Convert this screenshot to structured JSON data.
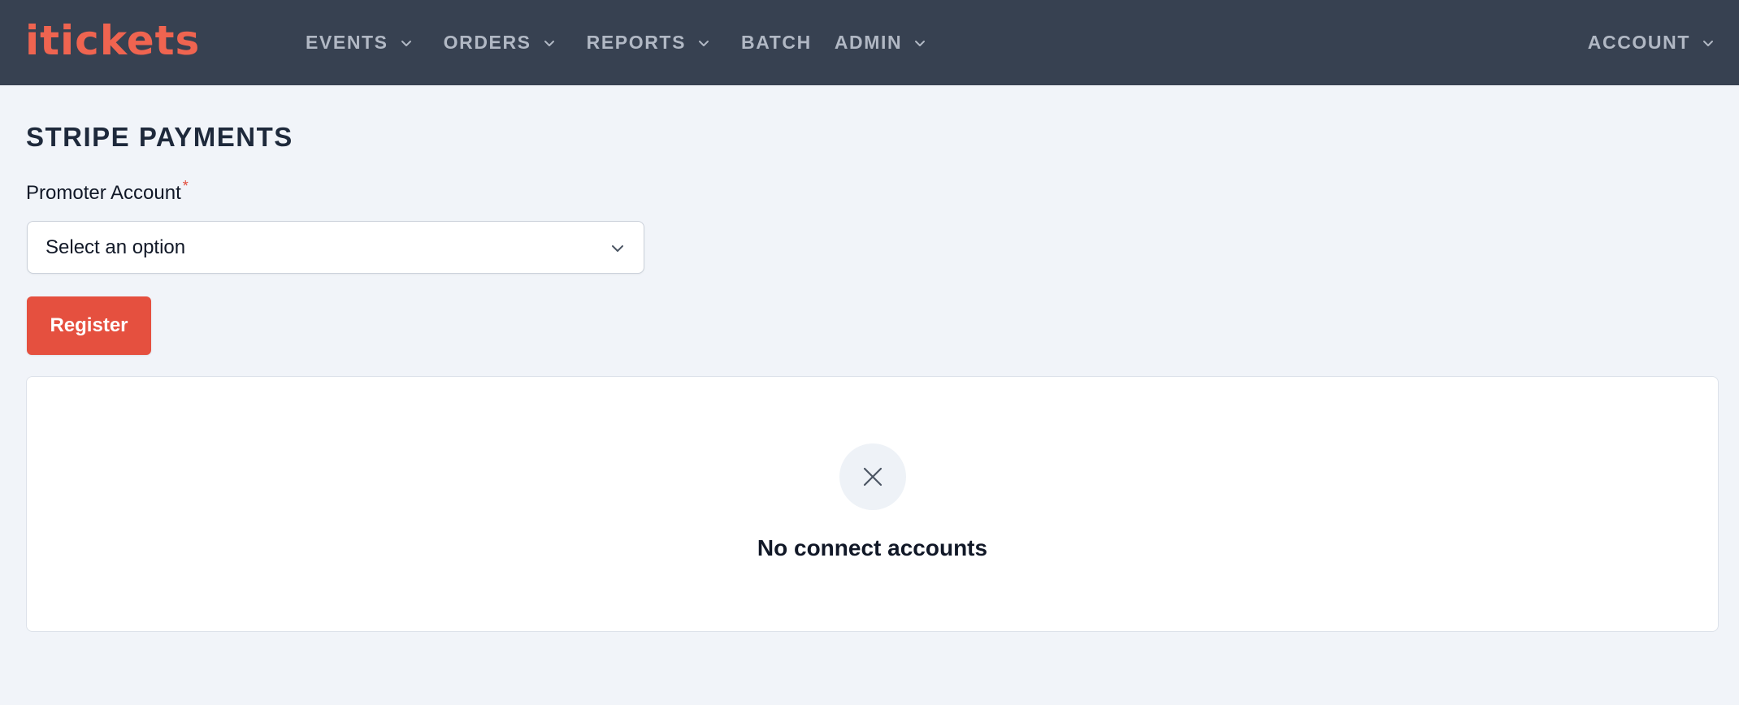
{
  "brand": {
    "logo_text": "iTickets",
    "accent_color": "#e5503f"
  },
  "nav": {
    "items": [
      {
        "label": "EVENTS",
        "has_dropdown": true
      },
      {
        "label": "ORDERS",
        "has_dropdown": true
      },
      {
        "label": "REPORTS",
        "has_dropdown": true
      },
      {
        "label": "BATCH",
        "has_dropdown": false
      },
      {
        "label": "ADMIN",
        "has_dropdown": true
      }
    ],
    "account_label": "ACCOUNT"
  },
  "page": {
    "title": "STRIPE PAYMENTS",
    "promoter_field": {
      "label": "Promoter Account",
      "required_marker": "*",
      "selected_value": "Select an option"
    },
    "register_label": "Register",
    "empty_state": {
      "icon": "x-icon",
      "message": "No connect accounts"
    }
  }
}
